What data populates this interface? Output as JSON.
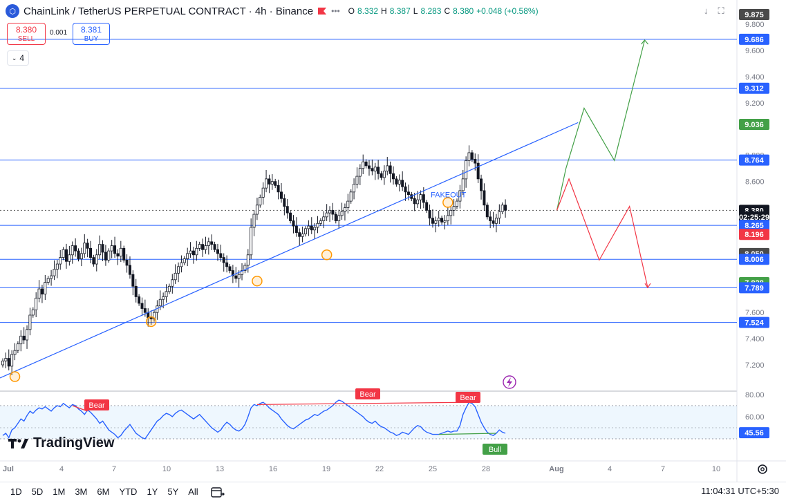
{
  "header": {
    "title": "ChainLink / TetherUS PERPETUAL CONTRACT · 4h · Binance",
    "logo_letter": "⬡",
    "ohlc": {
      "o_label": "O",
      "o": "8.332",
      "h_label": "H",
      "h": "8.387",
      "l_label": "L",
      "l": "8.283",
      "c_label": "C",
      "c": "8.380",
      "change": "+0.048 (+0.58%)"
    }
  },
  "trade": {
    "sell_price": "8.380",
    "sell_label": "SELL",
    "spread": "0.001",
    "buy_price": "8.381",
    "buy_label": "BUY"
  },
  "indicators_toggle": {
    "count": "4"
  },
  "brand": {
    "name": "TradingView"
  },
  "bottom_bar": {
    "ranges": [
      "1D",
      "5D",
      "1M",
      "3M",
      "6M",
      "YTD",
      "1Y",
      "5Y",
      "All"
    ],
    "clock": "11:04:31 UTC+5:30"
  },
  "chart_data": {
    "type": "candlestick",
    "symbol": "LINKUSDT.P",
    "interval": "4h",
    "y_ticks": [
      "9.800",
      "9.600",
      "9.400",
      "9.200",
      "8.800",
      "8.600",
      "7.600",
      "7.400",
      "7.200"
    ],
    "ylim": [
      7.05,
      9.875
    ],
    "x_ticks": [
      "Jul",
      "4",
      "7",
      "10",
      "13",
      "16",
      "19",
      "22",
      "25",
      "28",
      "Aug",
      "4",
      "7",
      "10"
    ],
    "horizontal_levels": [
      9.686,
      9.312,
      8.764,
      8.265,
      8.006,
      7.789,
      7.524
    ],
    "price_labels": [
      {
        "value": "9.875",
        "color": "#4a4a4a"
      },
      {
        "value": "9.686",
        "color": "#2962ff"
      },
      {
        "value": "9.312",
        "color": "#2962ff"
      },
      {
        "value": "9.036",
        "color": "#43a047"
      },
      {
        "value": "8.764",
        "color": "#2962ff"
      },
      {
        "value": "8.380",
        "color": "#131722"
      },
      {
        "value": "02:25:29",
        "color": "#131722"
      },
      {
        "value": "8.265",
        "color": "#2962ff"
      },
      {
        "value": "8.196",
        "color": "#f23645"
      },
      {
        "value": "8.050",
        "color": "#4a4a4a"
      },
      {
        "value": "8.006",
        "color": "#2962ff"
      },
      {
        "value": "7.828",
        "color": "#43a047"
      },
      {
        "value": "7.789",
        "color": "#2962ff"
      },
      {
        "value": "7.524",
        "color": "#2962ff"
      }
    ],
    "price_label_values": [
      9.875,
      9.686,
      9.312,
      9.036,
      8.764,
      8.38,
      8.33,
      8.265,
      8.196,
      8.05,
      8.006,
      7.828,
      7.789,
      7.524
    ],
    "current_price": 8.38,
    "trendline": {
      "from": [
        0,
        7.1
      ],
      "to": [
        190,
        9.05
      ]
    },
    "touch_points": [
      [
        4,
        7.11
      ],
      [
        49,
        7.53
      ],
      [
        84,
        7.84
      ],
      [
        107,
        8.04
      ],
      [
        147,
        8.44
      ]
    ],
    "annotation": "FAKEOUT",
    "bull_path": [
      [
        183,
        8.38
      ],
      [
        186,
        8.7
      ],
      [
        192,
        9.16
      ],
      [
        202,
        8.76
      ],
      [
        212,
        9.68
      ]
    ],
    "bear_path": [
      [
        183,
        8.38
      ],
      [
        187,
        8.62
      ],
      [
        197,
        8.0
      ],
      [
        207,
        8.41
      ],
      [
        213,
        7.79
      ]
    ],
    "closes": [
      7.23,
      7.25,
      7.19,
      7.28,
      7.31,
      7.36,
      7.42,
      7.39,
      7.47,
      7.58,
      7.62,
      7.71,
      7.78,
      7.74,
      7.83,
      7.86,
      7.88,
      7.93,
      7.97,
      8.02,
      8.08,
      7.99,
      8.04,
      8.11,
      8.07,
      8.01,
      8.05,
      8.13,
      8.09,
      8.02,
      7.97,
      8.04,
      8.12,
      8.06,
      8.0,
      8.07,
      8.11,
      8.05,
      8.03,
      8.09,
      8.0,
      7.96,
      7.89,
      7.8,
      7.72,
      7.67,
      7.63,
      7.6,
      7.56,
      7.55,
      7.6,
      7.65,
      7.7,
      7.72,
      7.76,
      7.8,
      7.85,
      7.9,
      7.95,
      7.98,
      8.01,
      8.05,
      8.07,
      8.04,
      8.09,
      8.12,
      8.08,
      8.11,
      8.14,
      8.12,
      8.08,
      8.05,
      8.02,
      7.98,
      7.95,
      7.92,
      7.88,
      7.86,
      7.89,
      7.92,
      7.96,
      8.04,
      8.25,
      8.35,
      8.42,
      8.48,
      8.55,
      8.62,
      8.58,
      8.6,
      8.57,
      8.52,
      8.47,
      8.41,
      8.36,
      8.3,
      8.26,
      8.21,
      8.18,
      8.2,
      8.24,
      8.26,
      8.23,
      8.25,
      8.28,
      8.3,
      8.33,
      8.36,
      8.38,
      8.35,
      8.3,
      8.34,
      8.37,
      8.4,
      8.45,
      8.52,
      8.58,
      8.64,
      8.7,
      8.75,
      8.72,
      8.7,
      8.68,
      8.71,
      8.66,
      8.63,
      8.68,
      8.72,
      8.66,
      8.62,
      8.58,
      8.61,
      8.56,
      8.52,
      8.5,
      8.47,
      8.43,
      8.46,
      8.5,
      8.44,
      8.38,
      8.32,
      8.28,
      8.3,
      8.32,
      8.29,
      8.3,
      8.34,
      8.38,
      8.41,
      8.45,
      8.53,
      8.62,
      8.76,
      8.82,
      8.77,
      8.74,
      8.62,
      8.53,
      8.42,
      8.33,
      8.3,
      8.28,
      8.32,
      8.37,
      8.42,
      8.38
    ],
    "rsi": {
      "type": "line",
      "y_ticks": [
        "80.00",
        "60.00"
      ],
      "ylim": [
        38,
        82
      ],
      "upper_band": 70,
      "lower_band": 40,
      "current": "45.56",
      "labels": {
        "bear": "Bear",
        "bull": "Bull"
      },
      "values": [
        43,
        45,
        41,
        48,
        50,
        54,
        58,
        56,
        61,
        65,
        63,
        66,
        68,
        67,
        69,
        67,
        65,
        68,
        70,
        69,
        72,
        70,
        68,
        71,
        70,
        67,
        65,
        62,
        66,
        64,
        61,
        58,
        54,
        56,
        52,
        48,
        46,
        44,
        41,
        43,
        47,
        50,
        53,
        49,
        45,
        43,
        41,
        40,
        44,
        48,
        52,
        56,
        58,
        61,
        63,
        62,
        60,
        63,
        65,
        66,
        64,
        62,
        60,
        58,
        60,
        62,
        59,
        56,
        53,
        50,
        48,
        46,
        48,
        52,
        55,
        53,
        50,
        48,
        47,
        49,
        53,
        60,
        68,
        71,
        70,
        72,
        73,
        71,
        68,
        66,
        64,
        62,
        58,
        55,
        52,
        50,
        49,
        51,
        53,
        55,
        57,
        58,
        60,
        62,
        61,
        63,
        65,
        66,
        68,
        70,
        73,
        75,
        74,
        72,
        70,
        68,
        66,
        64,
        62,
        60,
        57,
        55,
        54,
        56,
        53,
        51,
        50,
        48,
        46,
        45,
        43,
        44,
        46,
        45,
        44,
        47,
        50,
        52,
        51,
        48,
        46,
        45,
        44,
        44,
        44,
        45,
        46,
        47,
        46,
        47,
        47,
        52,
        62,
        68,
        73,
        72,
        69,
        62,
        55,
        50,
        46,
        44,
        43,
        45,
        48,
        46,
        45
      ]
    }
  }
}
